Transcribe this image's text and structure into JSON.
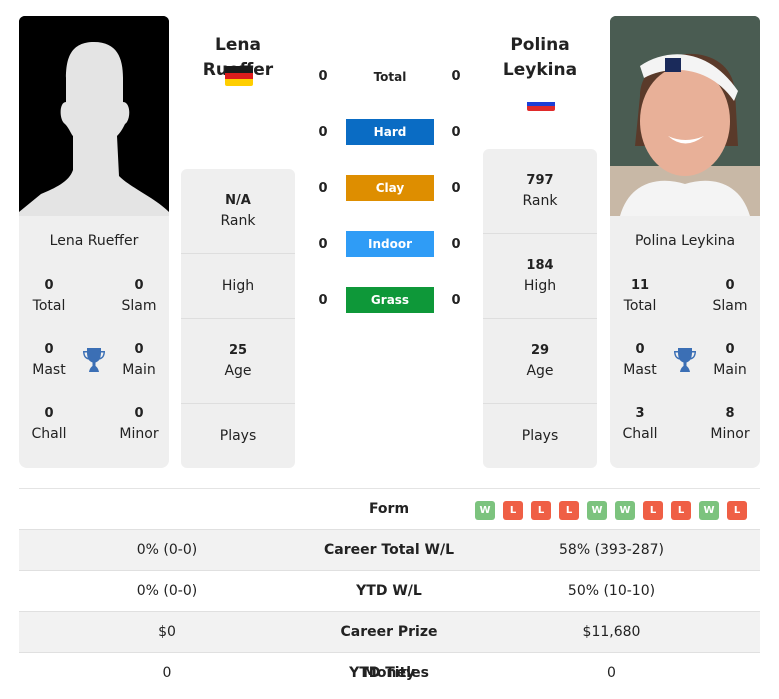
{
  "player1": {
    "name": "Lena Rueffer",
    "card_name": "Lena Rueffer",
    "flag": "germany",
    "flag_colors": [
      "#1a1a1a",
      "#dd1c1c",
      "#ffce00"
    ],
    "photo": "silhouette-placeholder",
    "titles": {
      "total": {
        "value": "0",
        "label": "Total"
      },
      "slam": {
        "value": "0",
        "label": "Slam"
      },
      "mast": {
        "value": "0",
        "label": "Mast"
      },
      "main": {
        "value": "0",
        "label": "Main"
      },
      "chall": {
        "value": "0",
        "label": "Chall"
      },
      "minor": {
        "value": "0",
        "label": "Minor"
      }
    },
    "stats": {
      "rank": {
        "value": "N/A",
        "label": "Rank"
      },
      "high": {
        "value": "",
        "label": "High"
      },
      "age": {
        "value": "25",
        "label": "Age"
      },
      "plays": {
        "value": "",
        "label": "Plays"
      }
    }
  },
  "player2": {
    "name": "Polina Leykina",
    "card_name": "Polina Leykina",
    "flag": "russia",
    "flag_colors": [
      "#ffffff",
      "#1c3fd6",
      "#e02a2a"
    ],
    "photo": "player-photo",
    "titles": {
      "total": {
        "value": "11",
        "label": "Total"
      },
      "slam": {
        "value": "0",
        "label": "Slam"
      },
      "mast": {
        "value": "0",
        "label": "Mast"
      },
      "main": {
        "value": "0",
        "label": "Main"
      },
      "chall": {
        "value": "3",
        "label": "Chall"
      },
      "minor": {
        "value": "8",
        "label": "Minor"
      }
    },
    "stats": {
      "rank": {
        "value": "797",
        "label": "Rank"
      },
      "high": {
        "value": "184",
        "label": "High"
      },
      "age": {
        "value": "29",
        "label": "Age"
      },
      "plays": {
        "value": "",
        "label": "Plays"
      }
    }
  },
  "surfaces": [
    {
      "label": "Total",
      "p1": "0",
      "p2": "0",
      "color": null
    },
    {
      "label": "Hard",
      "p1": "0",
      "p2": "0",
      "color": "#0a6cc4"
    },
    {
      "label": "Clay",
      "p1": "0",
      "p2": "0",
      "color": "#de8e00"
    },
    {
      "label": "Indoor",
      "p1": "0",
      "p2": "0",
      "color": "#2f9cf6"
    },
    {
      "label": "Grass",
      "p1": "0",
      "p2": "0",
      "color": "#0e9839"
    }
  ],
  "h2h": {
    "form_label": "Form",
    "form": [
      "W",
      "L",
      "L",
      "L",
      "W",
      "W",
      "L",
      "L",
      "W",
      "L"
    ],
    "rows": [
      {
        "label": "Career Total W/L",
        "p1": "0% (0-0)",
        "p2": "58% (393-287)"
      },
      {
        "label": "YTD W/L",
        "p1": "0% (0-0)",
        "p2": "50% (10-10)"
      },
      {
        "label": "Career Prize Money",
        "p1": "$0",
        "p2": "$11,680"
      },
      {
        "label": "YTD Titles",
        "p1": "0",
        "p2": "0"
      }
    ]
  },
  "icons": {
    "trophy": "trophy-icon",
    "trophy_color": "#3b6fb5"
  }
}
